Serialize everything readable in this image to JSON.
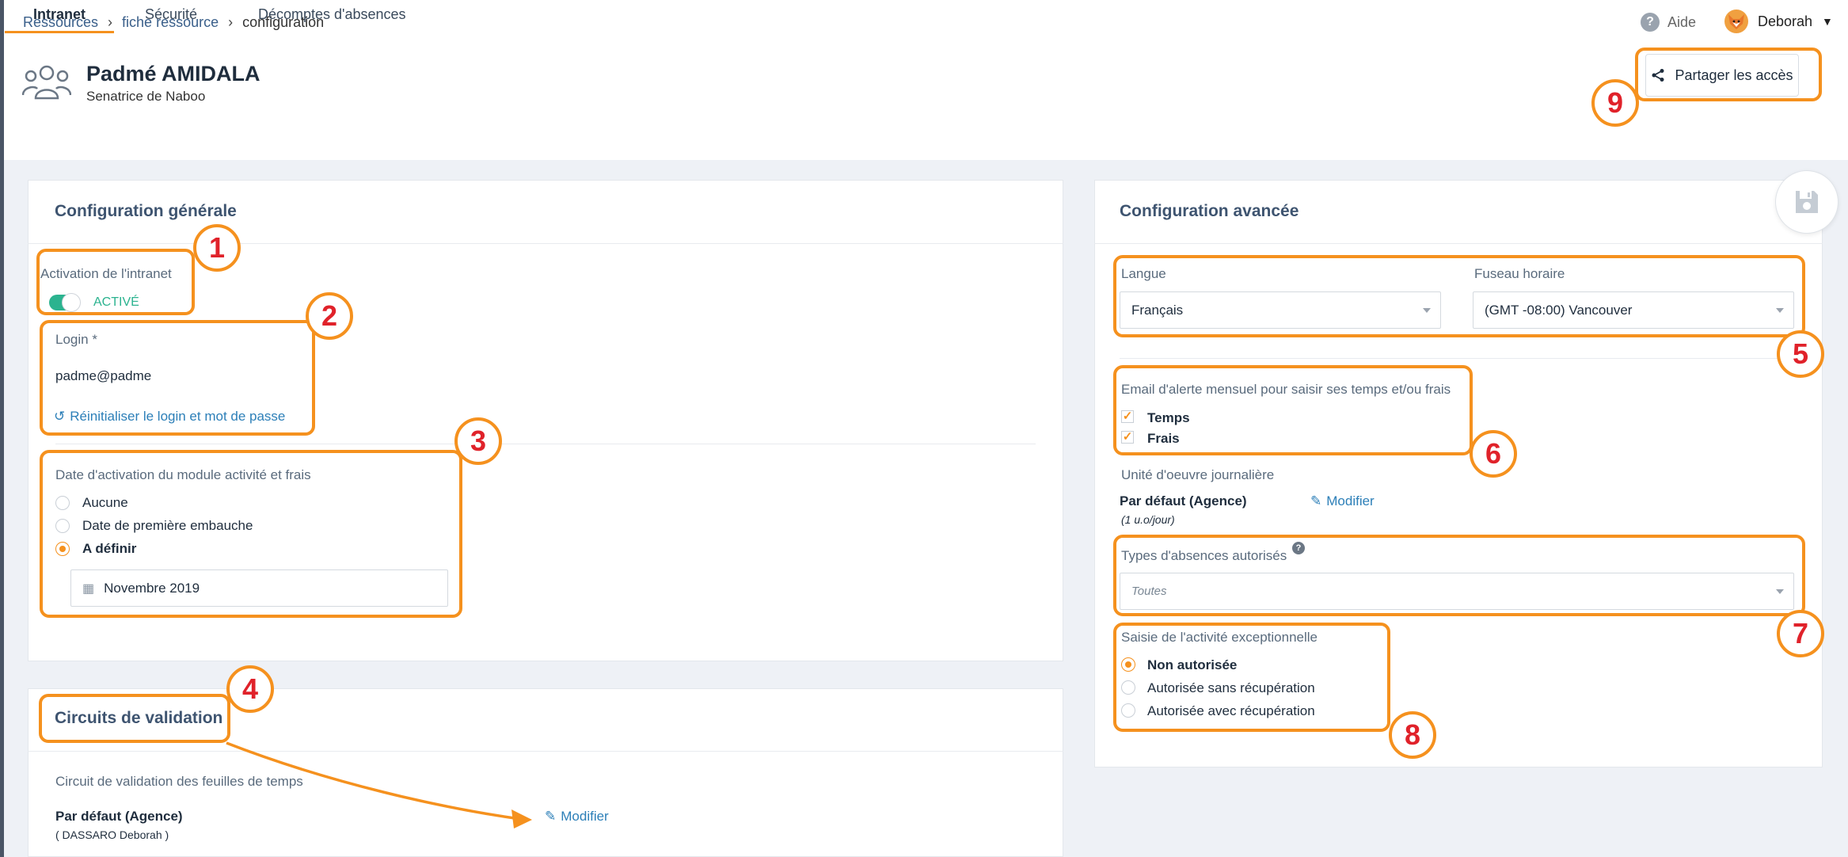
{
  "breadcrumb": [
    "Ressources",
    "fiche ressource",
    "configuration"
  ],
  "header": {
    "help_label": "Aide",
    "user_name": "Deborah",
    "person_name": "Padmé AMIDALA",
    "person_subtitle": "Senatrice de Naboo",
    "share_label": "Partager les accès"
  },
  "tabs": [
    {
      "label": "Intranet",
      "active": true
    },
    {
      "label": "Sécurité",
      "active": false
    },
    {
      "label": "Décomptes d'absences",
      "active": false
    }
  ],
  "general": {
    "title": "Configuration générale",
    "intranet_label": "Activation de l'intranet",
    "intranet_status": "ACTIVÉ",
    "login_label": "Login *",
    "login_value": "padme@padme",
    "reset_link": "Réinitialiser le login et mot de passe",
    "date_label": "Date d'activation du module activité et frais",
    "date_options": [
      "Aucune",
      "Date de première embauche",
      "A définir"
    ],
    "date_selected": 2,
    "date_value": "Novembre 2019"
  },
  "circuits": {
    "title": "Circuits de validation",
    "subtitle": "Circuit de validation des feuilles de temps",
    "default_label": "Par défaut (Agence)",
    "default_sub": "( DASSARO Deborah )",
    "modify_link": "Modifier"
  },
  "advanced": {
    "title": "Configuration avancée",
    "lang_label": "Langue",
    "lang_value": "Français",
    "tz_label": "Fuseau horaire",
    "tz_value": "(GMT -08:00) Vancouver",
    "email_label": "Email d'alerte mensuel pour saisir ses temps et/ou frais",
    "email_options": [
      "Temps",
      "Frais"
    ],
    "unit_label": "Unité d'oeuvre journalière",
    "unit_default": "Par défaut (Agence)",
    "unit_sub": "(1 u.o/jour)",
    "unit_modify": "Modifier",
    "absence_label": "Types d'absences autorisés",
    "absence_value": "Toutes",
    "exc_label": "Saisie de l'activité exceptionnelle",
    "exc_options": [
      "Non autorisée",
      "Autorisée sans récupération",
      "Autorisée avec récupération"
    ],
    "exc_selected": 0
  },
  "annotations": [
    "1",
    "2",
    "3",
    "4",
    "5",
    "6",
    "7",
    "8",
    "9"
  ],
  "colors": {
    "accent": "#f5911e",
    "marker": "#e0222a",
    "toggle": "#2bb38f",
    "link": "#2c7fb8"
  }
}
